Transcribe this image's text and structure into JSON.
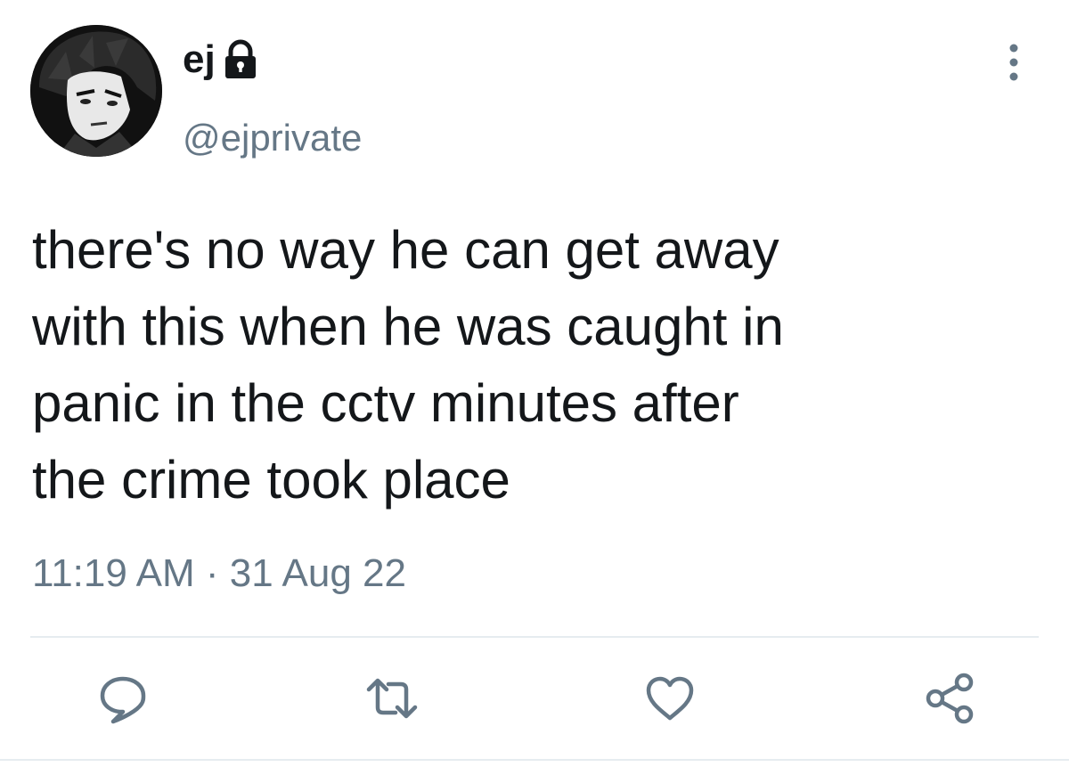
{
  "author": {
    "display_name": "ej",
    "handle": "@ejprivate",
    "avatar_icon": "anime-character-avatar",
    "verified_lock_icon": "lock-icon"
  },
  "tweet": {
    "text": "there's no way he can get away\nwith this when he was caught in\npanic in the cctv minutes after\nthe crime took place",
    "time": "11:19 AM",
    "separator": "·",
    "date": "31 Aug 22"
  },
  "actions": [
    {
      "name": "reply",
      "icon": "comment-icon"
    },
    {
      "name": "retweet",
      "icon": "retweet-icon"
    },
    {
      "name": "like",
      "icon": "heart-icon"
    },
    {
      "name": "share",
      "icon": "share-icon"
    }
  ],
  "colors": {
    "text": "#14171a",
    "secondary": "#657786",
    "divider": "#e6ecf0"
  }
}
